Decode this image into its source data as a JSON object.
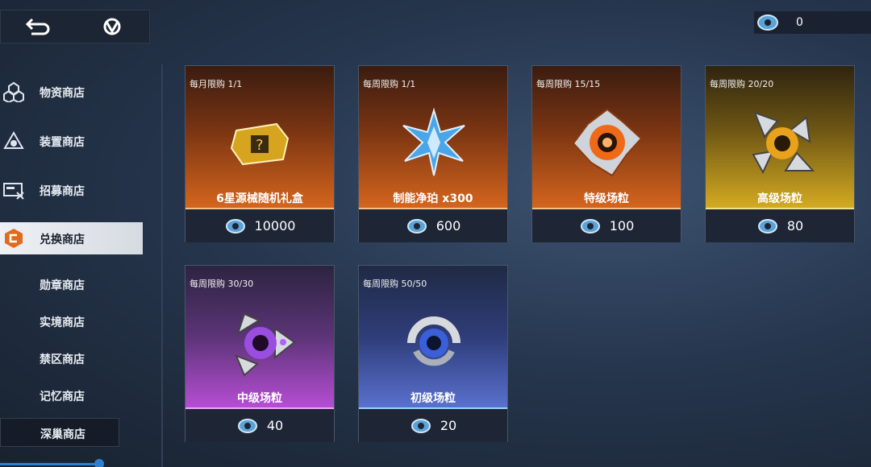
{
  "topbar": {
    "back_icon": "back-arrow-icon",
    "home_icon": "home-logo-icon"
  },
  "currency": {
    "amount": "0",
    "icon": "coin-token-icon"
  },
  "sidebar": {
    "items": [
      {
        "label": "物资商店",
        "icon": "supply-icon"
      },
      {
        "label": "装置商店",
        "icon": "device-icon"
      },
      {
        "label": "招募商店",
        "icon": "recruit-icon"
      },
      {
        "label": "兑换商店",
        "icon": "exchange-icon"
      },
      {
        "label": "勋章商店"
      },
      {
        "label": "实境商店"
      },
      {
        "label": "禁区商店"
      },
      {
        "label": "记忆商店"
      },
      {
        "label": "深巢商店"
      }
    ]
  },
  "cards": [
    {
      "limit": "每月限购  1/1",
      "name": "6星源械随机礼盒",
      "price": "10000",
      "theme": "#c85a18",
      "item_icon": "gold-box-icon"
    },
    {
      "limit": "每周限购  1/1",
      "name": "制能净珀 x300",
      "price": "600",
      "theme": "#c85a18",
      "item_icon": "blue-crystal-icon"
    },
    {
      "limit": "每周限购  15/15",
      "name": "特级场粒",
      "price": "100",
      "theme": "#d0621a",
      "item_icon": "orange-core-icon"
    },
    {
      "limit": "每周限购  20/20",
      "name": "高级场粒",
      "price": "80",
      "theme": "#c6a020",
      "item_icon": "gold-core-icon"
    },
    {
      "limit": "每周限购  30/30",
      "name": "中级场粒",
      "price": "40",
      "theme": "#a845c8",
      "item_icon": "purple-core-icon"
    },
    {
      "limit": "每周限购  50/50",
      "name": "初级场粒",
      "price": "20",
      "theme": "#4a68c0",
      "item_icon": "blue-core-icon"
    }
  ]
}
